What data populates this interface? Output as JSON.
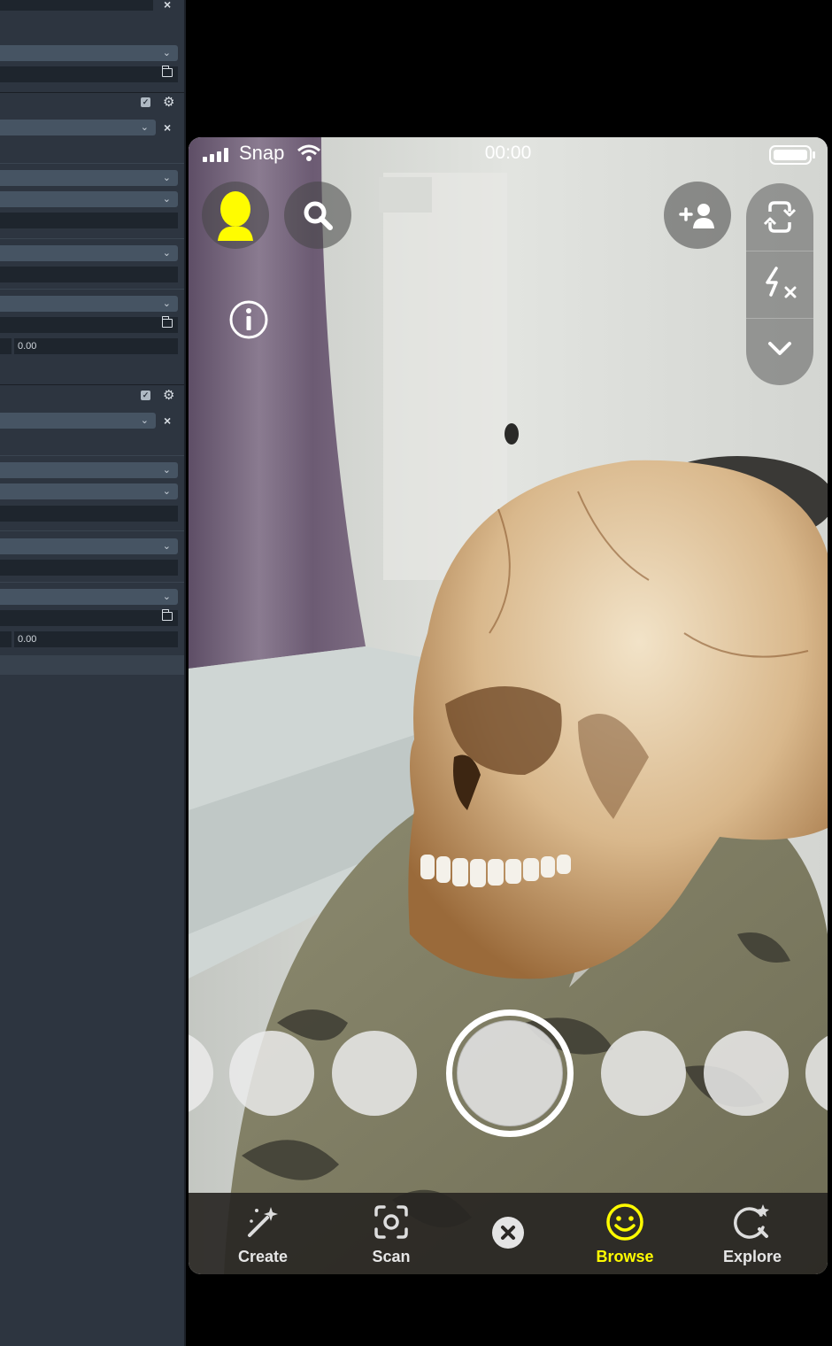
{
  "inspector": {
    "field_a": "0.00",
    "field_b": "0.00"
  },
  "phone": {
    "status": {
      "carrier": "Snap",
      "time": "00:00"
    },
    "nav": {
      "create": "Create",
      "scan": "Scan",
      "browse": "Browse",
      "explore": "Explore"
    },
    "colors": {
      "accent": "#FFFC00",
      "nav_bg": "#2a2724"
    }
  }
}
